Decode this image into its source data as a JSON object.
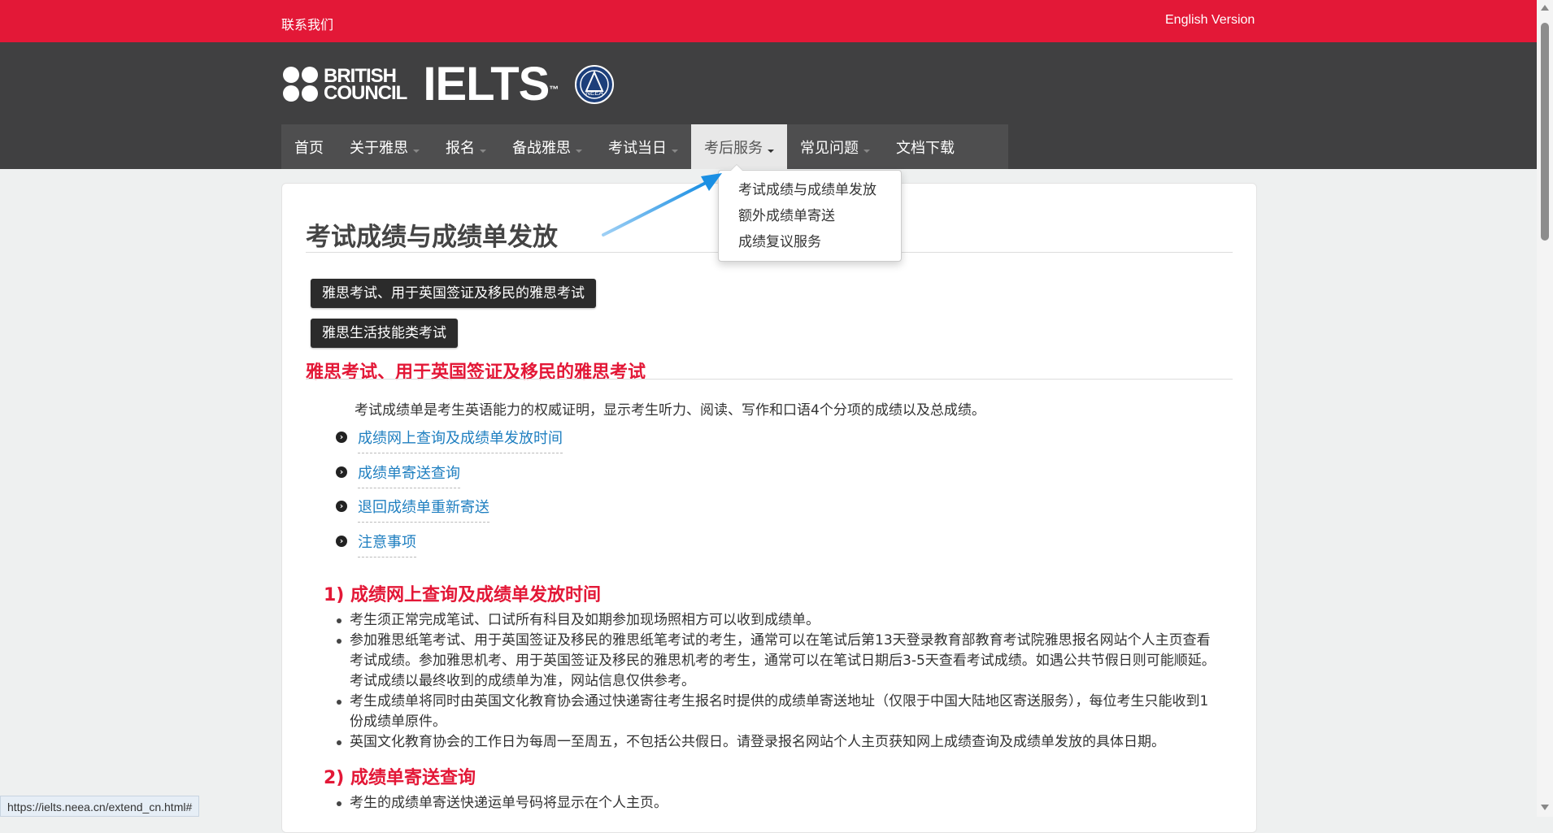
{
  "topbar": {
    "contact": "联系我们",
    "english": "English Version"
  },
  "logos": {
    "bc_line1": "BRITISH",
    "bc_line2": "COUNCIL",
    "ielts": "IELTS",
    "ielts_tm": "™",
    "seal_text": "NEEA"
  },
  "nav": {
    "items": [
      {
        "label": "首页",
        "caret": false
      },
      {
        "label": "关于雅思",
        "caret": true
      },
      {
        "label": "报名",
        "caret": true
      },
      {
        "label": "备战雅思",
        "caret": true
      },
      {
        "label": "考试当日",
        "caret": true
      },
      {
        "label": "考后服务",
        "caret": true,
        "active": true
      },
      {
        "label": "常见问题",
        "caret": true
      },
      {
        "label": "文档下载",
        "caret": false
      }
    ]
  },
  "dropdown": {
    "items": [
      "考试成绩与成绩单发放",
      "额外成绩单寄送",
      "成绩复议服务"
    ]
  },
  "main": {
    "title": "考试成绩与成绩单发放",
    "buttons": [
      "雅思考试、用于英国签证及移民的雅思考试",
      "雅思生活技能类考试"
    ],
    "section_title": "雅思考试、用于英国签证及移民的雅思考试",
    "intro": "考试成绩单是考生英语能力的权威证明，显示考生听力、阅读、写作和口语4个分项的成绩以及总成绩。",
    "toc": [
      "成绩网上查询及成绩单发放时间",
      "成绩单寄送查询",
      "退回成绩单重新寄送",
      "注意事项"
    ],
    "section1": {
      "heading": "1) 成绩网上查询及成绩单发放时间",
      "bullets": [
        "考生须正常完成笔试、口试所有科目及如期参加现场照相方可以收到成绩单。",
        "参加雅思纸笔考试、用于英国签证及移民的雅思纸笔考试的考生，通常可以在笔试后第13天登录教育部教育考试院雅思报名网站个人主页查看考试成绩。参加雅思机考、用于英国签证及移民的雅思机考的考生，通常可以在笔试日期后3-5天查看考试成绩。如遇公共节假日则可能顺延。考试成绩以最终收到的成绩单为准，网站信息仅供参考。",
        "考生成绩单将同时由英国文化教育协会通过快递寄往考生报名时提供的成绩单寄送地址（仅限于中国大陆地区寄送服务），每位考生只能收到1份成绩单原件。",
        "英国文化教育协会的工作日为每周一至周五，不包括公共假日。请登录报名网站个人主页获知网上成绩查询及成绩单发放的具体日期。"
      ]
    },
    "section2": {
      "heading": "2) 成绩单寄送查询",
      "bullets": [
        "考生的成绩单寄送快递运单号码将显示在个人主页。"
      ]
    }
  },
  "status_url": "https://ielts.neea.cn/extend_cn.html#",
  "colors": {
    "brand_red": "#e31837",
    "header_dark": "#404041",
    "link_blue": "#1f7fc0"
  }
}
